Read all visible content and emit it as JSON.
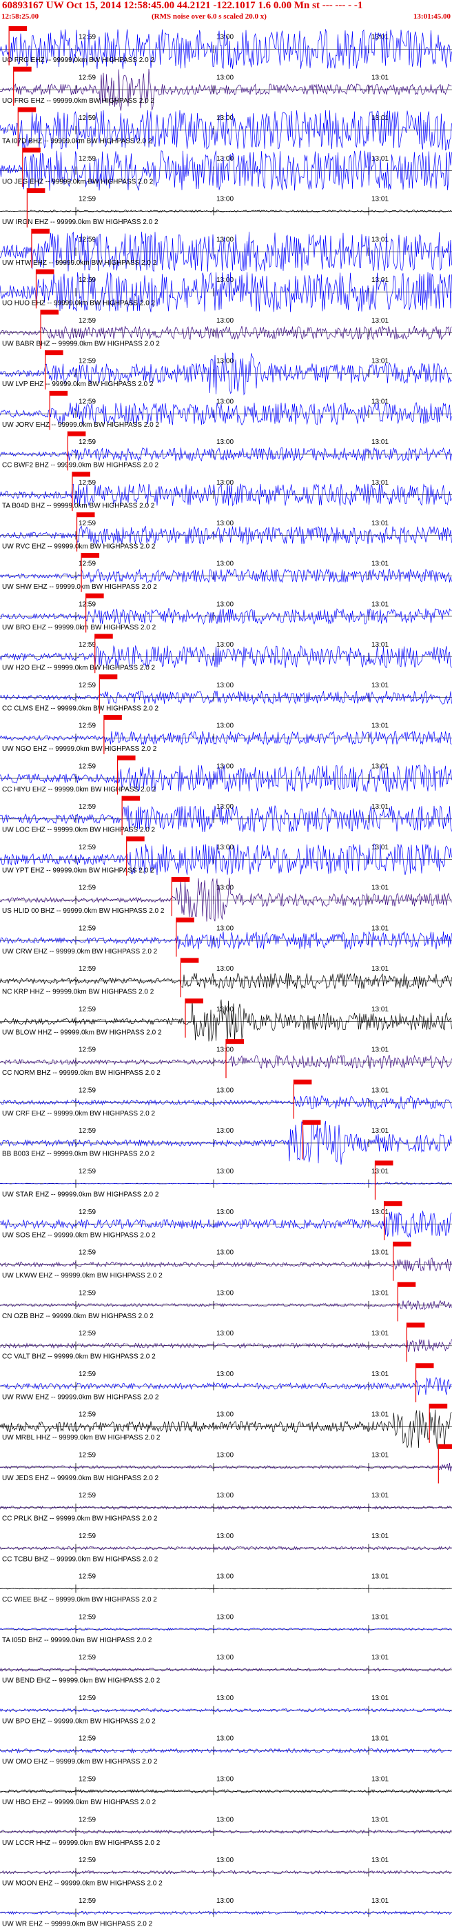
{
  "header": {
    "title": "60893167 UW Oct 15, 2014 12:58:45.00   44.2121  -122.1017   1.6  0.00  Mn st --- --- -  -1",
    "start_time": "12:58:25.00",
    "noise_note": "(RMS noise over 6.0 s scaled 20.0 x)",
    "end_time": "13:01:45.00"
  },
  "chart_data": {
    "type": "line",
    "title": "60893167 UW Oct 15, 2014 12:58:45.00   44.2121  -122.1017   1.6  0.00  Mn st --- --- -  -1",
    "x_range": [
      "12:58:25",
      "13:01:45"
    ],
    "tick_labels": [
      "12:59",
      "13:00",
      "13:01"
    ],
    "label_suffix": " -- 99999.0km BW HIGHPASS 2.0 2",
    "colors": {
      "blue": "#0000ff",
      "indigo": "#3a0a80",
      "black": "#000000",
      "marker": "#ee0000"
    },
    "stations": [
      {
        "name": "UO FRG EHZ",
        "color": "blue",
        "amp": 0.9,
        "burst": 0,
        "pick": 0.02
      },
      {
        "name": "UO FRG EHZ",
        "color": "indigo",
        "amp": 0.25,
        "burst": 0.28,
        "pick": 0.03
      },
      {
        "name": "TA I07D BHZ",
        "color": "blue",
        "amp": 0.9,
        "burst": 0,
        "pick": 0.04
      },
      {
        "name": "UO JEG EHZ",
        "color": "blue",
        "amp": 0.9,
        "burst": 0,
        "pick": 0.05
      },
      {
        "name": "UW IRGN EHZ",
        "color": "black",
        "amp": 0.05,
        "burst": 0,
        "pick": 0.06
      },
      {
        "name": "UW HTW EHZ",
        "color": "blue",
        "amp": 0.9,
        "burst": 0,
        "pick": 0.07
      },
      {
        "name": "UO HUO EHZ",
        "color": "blue",
        "amp": 0.9,
        "burst": 0,
        "pick": 0.08
      },
      {
        "name": "UW BABR BHZ",
        "color": "indigo",
        "amp": 0.3,
        "burst": 0,
        "pick": 0.09
      },
      {
        "name": "UW LVP EHZ",
        "color": "blue",
        "amp": 0.45,
        "burst": 0.52,
        "pick": 0.1
      },
      {
        "name": "UW JORV EHZ",
        "color": "blue",
        "amp": 0.5,
        "burst": 0,
        "pick": 0.11
      },
      {
        "name": "CC BWF2 BHZ",
        "color": "blue",
        "amp": 0.3,
        "burst": 0,
        "pick": 0.15
      },
      {
        "name": "TA B04D BHZ",
        "color": "blue",
        "amp": 0.5,
        "burst": 0,
        "pick": 0.16
      },
      {
        "name": "UW RVC EHZ",
        "color": "blue",
        "amp": 0.4,
        "burst": 0,
        "pick": 0.17
      },
      {
        "name": "UW SHW EHZ",
        "color": "blue",
        "amp": 0.3,
        "burst": 0,
        "pick": 0.18
      },
      {
        "name": "UW BRO EHZ",
        "color": "blue",
        "amp": 0.35,
        "burst": 0,
        "pick": 0.19
      },
      {
        "name": "UW H2O EHZ",
        "color": "blue",
        "amp": 0.5,
        "burst": 0,
        "pick": 0.21
      },
      {
        "name": "CC CLMS EHZ",
        "color": "blue",
        "amp": 0.3,
        "burst": 0,
        "pick": 0.22
      },
      {
        "name": "UW NGO EHZ",
        "color": "blue",
        "amp": 0.3,
        "burst": 0,
        "pick": 0.23
      },
      {
        "name": "CC HIYU EHZ",
        "color": "blue",
        "amp": 0.6,
        "burst": 0,
        "pick": 0.26
      },
      {
        "name": "UW LOC EHZ",
        "color": "blue",
        "amp": 0.6,
        "burst": 0,
        "pick": 0.27
      },
      {
        "name": "UW YPT EHZ",
        "color": "blue",
        "amp": 0.7,
        "burst": 0,
        "pick": 0.28
      },
      {
        "name": "US HLID 00 BHZ",
        "color": "indigo",
        "amp": 0.3,
        "burst": 0.45,
        "pick": 0.38
      },
      {
        "name": "UW CRW EHZ",
        "color": "blue",
        "amp": 0.4,
        "burst": 0,
        "pick": 0.39
      },
      {
        "name": "NC KRP HHZ",
        "color": "black",
        "amp": 0.35,
        "burst": 0,
        "pick": 0.4
      },
      {
        "name": "UW BLOW HHZ",
        "color": "black",
        "amp": 0.4,
        "burst": 0.48,
        "pick": 0.41
      },
      {
        "name": "CC NORM BHZ",
        "color": "indigo",
        "amp": 0.3,
        "burst": 0,
        "pick": 0.5
      },
      {
        "name": "UW CRF EHZ",
        "color": "blue",
        "amp": 0.3,
        "burst": 0,
        "pick": 0.65
      },
      {
        "name": "BB B003 EHZ",
        "color": "blue",
        "amp": 0.4,
        "burst": 0.7,
        "pick": 0.67
      },
      {
        "name": "UW STAR EHZ",
        "color": "blue",
        "amp": 0.05,
        "burst": 0,
        "pick": 0.83
      },
      {
        "name": "UW SOS EHZ",
        "color": "blue",
        "amp": 0.6,
        "burst": 0,
        "pick": 0.85
      },
      {
        "name": "UW LKWW EHZ",
        "color": "indigo",
        "amp": 0.3,
        "burst": 0,
        "pick": 0.87
      },
      {
        "name": "CN OZB BHZ",
        "color": "indigo",
        "amp": 0.2,
        "burst": 0,
        "pick": 0.88
      },
      {
        "name": "CC VALT BHZ",
        "color": "indigo",
        "amp": 0.3,
        "burst": 0,
        "pick": 0.9
      },
      {
        "name": "UW RWW EHZ",
        "color": "blue",
        "amp": 0.4,
        "burst": 0,
        "pick": 0.92
      },
      {
        "name": "UW MRBL HHZ",
        "color": "black",
        "amp": 0.7,
        "burst": 0.93,
        "pick": 0.95
      },
      {
        "name": "UW JEDS EHZ",
        "color": "indigo",
        "amp": 0.2,
        "burst": 0,
        "pick": 0.97
      },
      {
        "name": "CC PRLK BHZ",
        "color": "indigo",
        "amp": 0.2,
        "burst": 0,
        "pick": 0
      },
      {
        "name": "CC TCBU BHZ",
        "color": "indigo",
        "amp": 0.2,
        "burst": 0,
        "pick": 0
      },
      {
        "name": "CC WIEE BHZ",
        "color": "black",
        "amp": 0.05,
        "burst": 0,
        "pick": 0
      },
      {
        "name": "TA I05D BHZ",
        "color": "blue",
        "amp": 0.15,
        "burst": 0,
        "pick": 0
      },
      {
        "name": "UW BEND EHZ",
        "color": "indigo",
        "amp": 0.2,
        "burst": 0,
        "pick": 0
      },
      {
        "name": "UW BPO EHZ",
        "color": "blue",
        "amp": 0.2,
        "burst": 0,
        "pick": 0
      },
      {
        "name": "UW OMO EHZ",
        "color": "blue",
        "amp": 0.25,
        "burst": 0,
        "pick": 0
      },
      {
        "name": "UW HBO EHZ",
        "color": "black",
        "amp": 0.2,
        "burst": 0,
        "pick": 0
      },
      {
        "name": "UW LCCR HHZ",
        "color": "indigo",
        "amp": 0.2,
        "burst": 0,
        "pick": 0
      },
      {
        "name": "UW MOON EHZ",
        "color": "indigo",
        "amp": 0.2,
        "burst": 0,
        "pick": 0
      },
      {
        "name": "UW WR EHZ",
        "color": "blue",
        "amp": 0.2,
        "burst": 0,
        "pick": 0
      }
    ]
  }
}
